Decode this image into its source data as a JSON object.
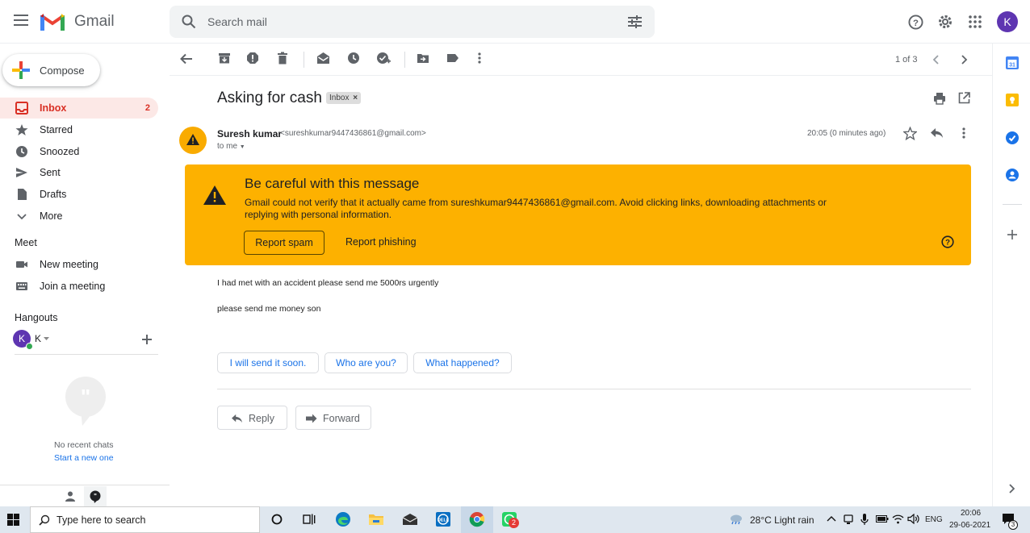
{
  "app": {
    "name": "Gmail"
  },
  "header": {
    "search_placeholder": "Search mail",
    "account_initial": "K"
  },
  "sidebar": {
    "compose_label": "Compose",
    "items": [
      {
        "label": "Inbox",
        "count": "2"
      },
      {
        "label": "Starred"
      },
      {
        "label": "Snoozed"
      },
      {
        "label": "Sent"
      },
      {
        "label": "Drafts"
      },
      {
        "label": "More"
      }
    ],
    "meet": {
      "title": "Meet",
      "items": [
        {
          "label": "New meeting"
        },
        {
          "label": "Join a meeting"
        }
      ]
    },
    "hangouts": {
      "title": "Hangouts",
      "user": "K",
      "no_chats": "No recent chats",
      "start_link": "Start a new one"
    }
  },
  "toolbar": {
    "pager": "1 of 3"
  },
  "message": {
    "subject": "Asking for cash",
    "label_chip": "Inbox",
    "sender_name": "Suresh kumar",
    "sender_email": "<sureshkumar9447436861@gmail.com>",
    "to": "to me",
    "time": "20:05 (0 minutes ago)",
    "warning": {
      "title": "Be careful with this message",
      "text": "Gmail could not verify that it actually came from sureshkumar9447436861@gmail.com. Avoid clicking links, downloading attachments or replying with personal information.",
      "report_spam": "Report spam",
      "report_phishing": "Report phishing"
    },
    "body": [
      "I had met with an accident please send me 5000rs urgently",
      "please send me money son"
    ],
    "smart_replies": [
      "I will send it soon.",
      "Who are you?",
      "What happened?"
    ],
    "reply_label": "Reply",
    "forward_label": "Forward"
  },
  "taskbar": {
    "search_placeholder": "Type here to search",
    "weather": "28°C  Light rain",
    "lang": "ENG",
    "time": "20:06",
    "date": "29-06-2021",
    "whatsapp_badge": "2",
    "notification_count": "3"
  },
  "colors": {
    "warning_bg": "#fdb100",
    "inbox_active_bg": "#fce8e6",
    "inbox_active_text": "#d93025",
    "link_blue": "#1a73e8"
  }
}
